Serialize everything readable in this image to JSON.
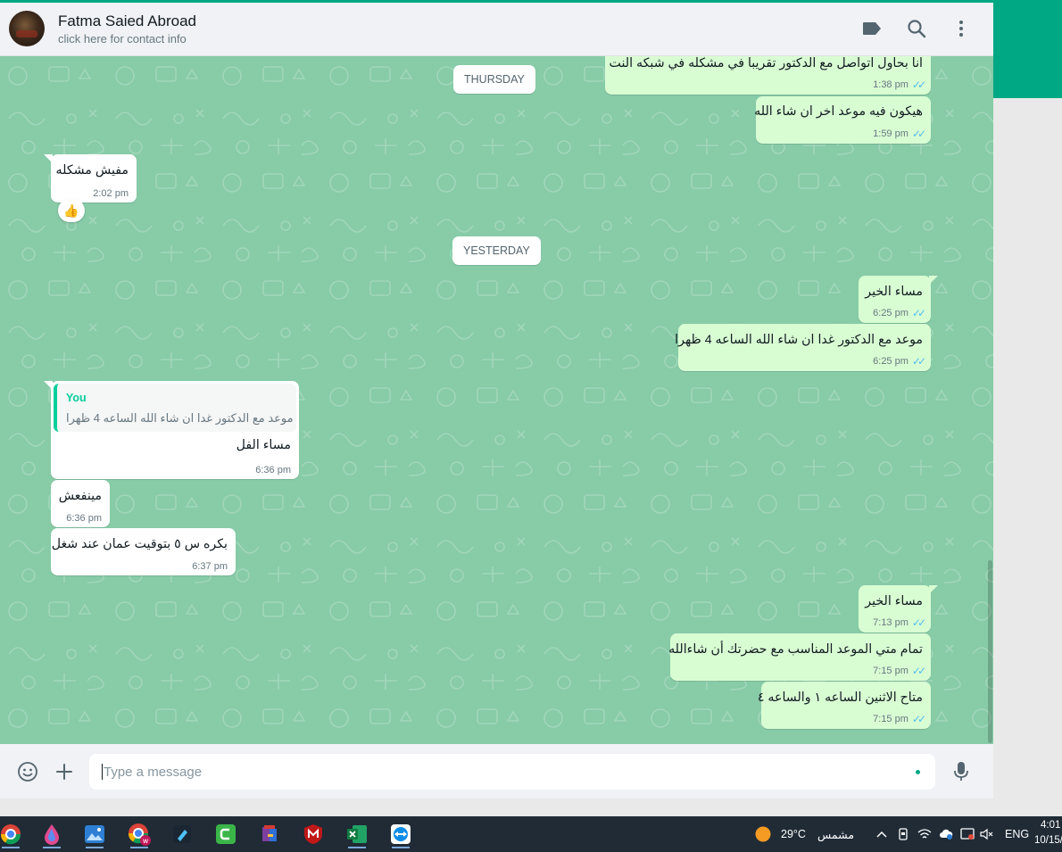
{
  "header": {
    "contact_name": "Fatma Saied Abroad",
    "contact_sub": "click here for contact info",
    "icons": [
      "label-icon",
      "search-icon",
      "menu-icon"
    ]
  },
  "dates": {
    "thursday": "THURSDAY",
    "yesterday": "YESTERDAY"
  },
  "messages": {
    "m1": {
      "text": "انا بحاول اتواصل مع الدكتور تقريبا في مشكله في شبكه النت",
      "time": "1:38 pm",
      "direction": "out",
      "status": "read"
    },
    "m2": {
      "text": "هيكون فيه موعد اخر ان شاء الله",
      "time": "1:59 pm",
      "direction": "out",
      "status": "read"
    },
    "m3": {
      "text": "مفيش مشكله",
      "time": "2:02 pm",
      "direction": "in",
      "reaction": "👍"
    },
    "m4": {
      "text": "مساء الخير",
      "time": "6:25 pm",
      "direction": "out",
      "status": "read"
    },
    "m5": {
      "text": "موعد مع الدكتور غدا ان شاء الله الساعه 4 ظهرا",
      "time": "6:25 pm",
      "direction": "out",
      "status": "read"
    },
    "m6": {
      "quote_author": "You",
      "quote_text": "موعد مع الدكتور غدا ان شاء الله الساعه 4 ظهرا",
      "text": "مساء الفل",
      "time": "6:36 pm",
      "direction": "in"
    },
    "m7": {
      "text": "مينفعش",
      "time": "6:36 pm",
      "direction": "in"
    },
    "m8": {
      "text": "بكره س ٥ بتوقيت عمان عند شغل",
      "time": "6:37 pm",
      "direction": "in"
    },
    "m9": {
      "text": "مساء الخير",
      "time": "7:13 pm",
      "direction": "out",
      "status": "read"
    },
    "m10": {
      "text": "تمام متي الموعد المناسب مع حضرتك أن شاءالله",
      "time": "7:15 pm",
      "direction": "out",
      "status": "read"
    },
    "m11": {
      "text": "متاح الاثنين الساعه ١ والساعه ٤",
      "time": "7:15 pm",
      "direction": "out",
      "status": "read"
    }
  },
  "composer": {
    "placeholder": "Type a message",
    "value": ""
  },
  "taskbar": {
    "weather_temp": "29°C",
    "weather_desc": "مشمس",
    "language": "ENG",
    "clock_time": "4:01",
    "clock_date": "10/15/"
  },
  "colors": {
    "accent": "#00a884",
    "chat_bg": "#87cba7",
    "outgoing_bubble": "#d9fdd3",
    "incoming_bubble": "#ffffff",
    "read_ticks": "#53bdeb"
  }
}
